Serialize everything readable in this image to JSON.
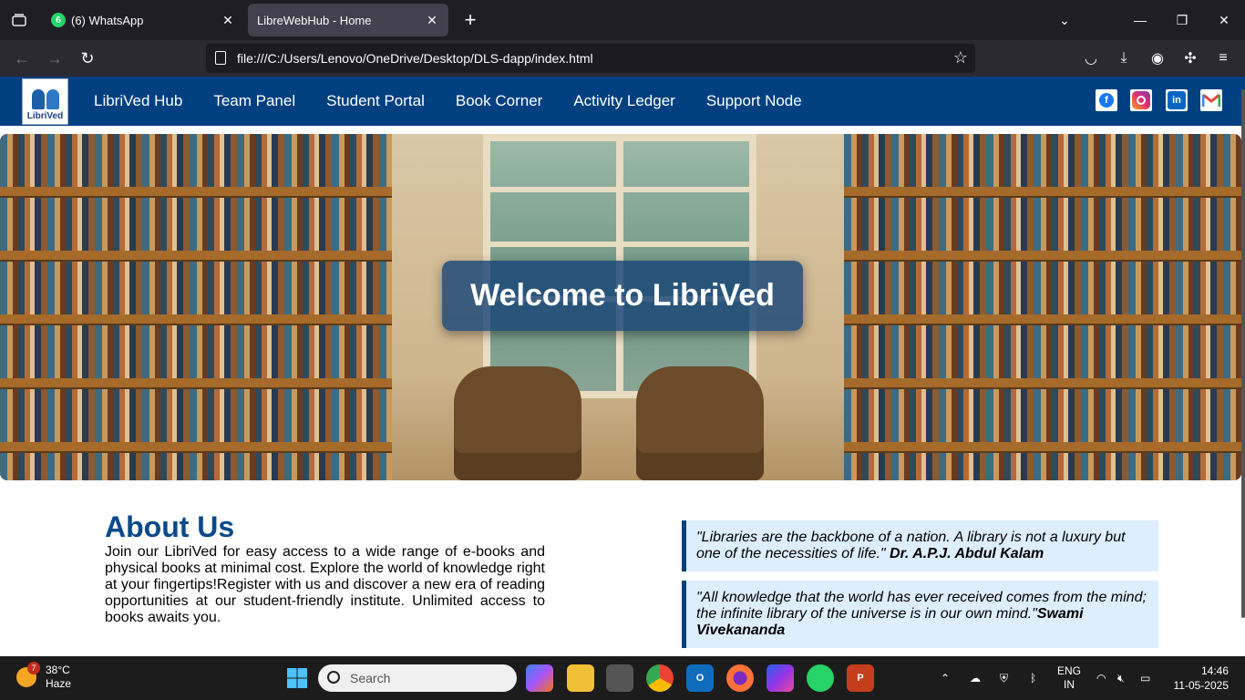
{
  "browser": {
    "tabs": [
      {
        "label": "(6) WhatsApp",
        "badge": "6"
      },
      {
        "label": "LibreWebHub - Home"
      }
    ],
    "url": "file:///C:/Users/Lenovo/OneDrive/Desktop/DLS-dapp/index.html"
  },
  "site": {
    "logo_text": "LibriVed",
    "nav": [
      "LibriVed Hub",
      "Team Panel",
      "Student Portal",
      "Book Corner",
      "Activity Ledger",
      "Support Node"
    ],
    "social": [
      "facebook-icon",
      "instagram-icon",
      "linkedin-icon",
      "gmail-icon"
    ],
    "hero_title": "Welcome to LibriVed",
    "about": {
      "heading": "About Us",
      "text": "Join our LibriVed for easy access to a wide range of e-books and physical books at minimal cost. Explore the world of knowledge right at your fingertips!Register with us and discover a new era of reading opportunities at our student-friendly institute. Unlimited access to books awaits you."
    },
    "quotes": [
      {
        "text": "\"Libraries are the backbone of a nation. A library is not a luxury but one of the necessities of life.\"",
        "author": " Dr. A.P.J. Abdul Kalam"
      },
      {
        "text": "\"All knowledge that the world has ever received comes from the mind; the infinite library of the universe is in our own mind.\"",
        "author": "Swami Vivekananda"
      }
    ]
  },
  "taskbar": {
    "weather_temp": "38°C",
    "weather_desc": "Haze",
    "weather_badge": "7",
    "search_placeholder": "Search",
    "lang_1": "ENG",
    "lang_2": "IN",
    "time": "14:46",
    "date": "11-05-2025"
  }
}
